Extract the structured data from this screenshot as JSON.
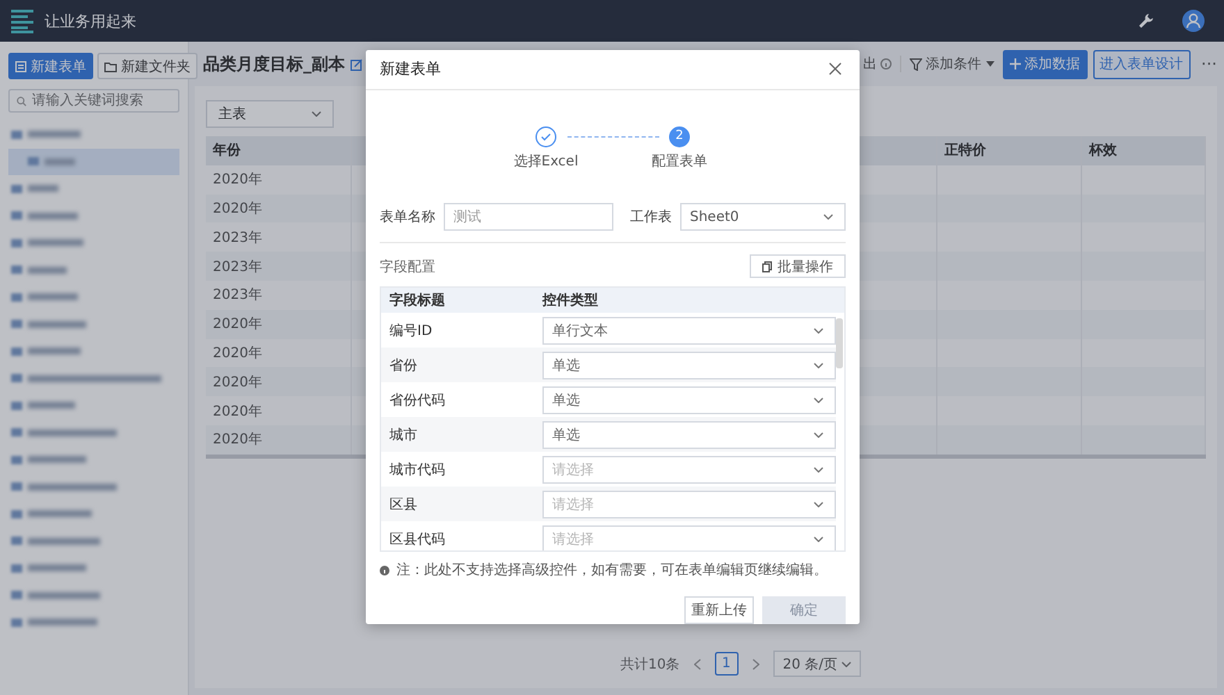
{
  "top_bar": {
    "title": "让业务用起来"
  },
  "sidebar": {
    "new_form": "新建表单",
    "new_folder": "新建文件夹",
    "search": {
      "placeholder": "请输入关键词搜索"
    },
    "items": [
      {
        "selected": false,
        "children": [
          {
            "selected": true
          }
        ]
      },
      {
        "selected": false
      },
      {
        "selected": false
      },
      {
        "selected": false
      },
      {
        "selected": false
      },
      {
        "selected": false
      },
      {
        "selected": false
      },
      {
        "selected": false
      },
      {
        "selected": false
      },
      {
        "selected": false
      },
      {
        "selected": false
      },
      {
        "selected": false
      },
      {
        "selected": false
      },
      {
        "selected": false
      },
      {
        "selected": false
      },
      {
        "selected": false
      },
      {
        "selected": false
      },
      {
        "selected": false
      }
    ]
  },
  "page": {
    "title": "品类月度目标_副本",
    "export": "出",
    "filter": "添加条件",
    "add": "添加数据",
    "design": "进入表单设计",
    "more": "···"
  },
  "table": {
    "selector": "主表",
    "columns": [
      "年份",
      "正特价",
      "杯效"
    ],
    "rows": [
      "2020年",
      "2020年",
      "2023年",
      "2023年",
      "2023年",
      "2020年",
      "2020年",
      "2020年",
      "2020年",
      "2020年"
    ]
  },
  "pagination": {
    "total": "共计10条",
    "page": "1",
    "page_size": "20 条/页"
  },
  "modal": {
    "title": "新建表单",
    "steps": [
      {
        "label": "选择Excel",
        "kind": "done"
      },
      {
        "label": "配置表单",
        "number": "2",
        "kind": "current"
      }
    ],
    "name_label": "表单名称",
    "name_value": "测试",
    "sheet_label": "工作表",
    "sheet_value": "Sheet0",
    "section": "字段配置",
    "batch_button": "批量操作",
    "field_columns": [
      "字段标题",
      "控件类型"
    ],
    "fields": [
      {
        "title": "编号ID",
        "type": "单行文本"
      },
      {
        "title": "省份",
        "type": "单选"
      },
      {
        "title": "省份代码",
        "type": "单选"
      },
      {
        "title": "城市",
        "type": "单选"
      },
      {
        "title": "城市代码",
        "placeholder": "请选择"
      },
      {
        "title": "区县",
        "placeholder": "请选择"
      },
      {
        "title": "区县代码",
        "placeholder": "请选择"
      }
    ],
    "note": "注：此处不支持选择高级控件，如有需要，可在表单编辑页继续编辑。",
    "buttons": [
      {
        "label": "重新上传",
        "disabled": false
      },
      {
        "label": "确定",
        "disabled": true
      }
    ]
  }
}
